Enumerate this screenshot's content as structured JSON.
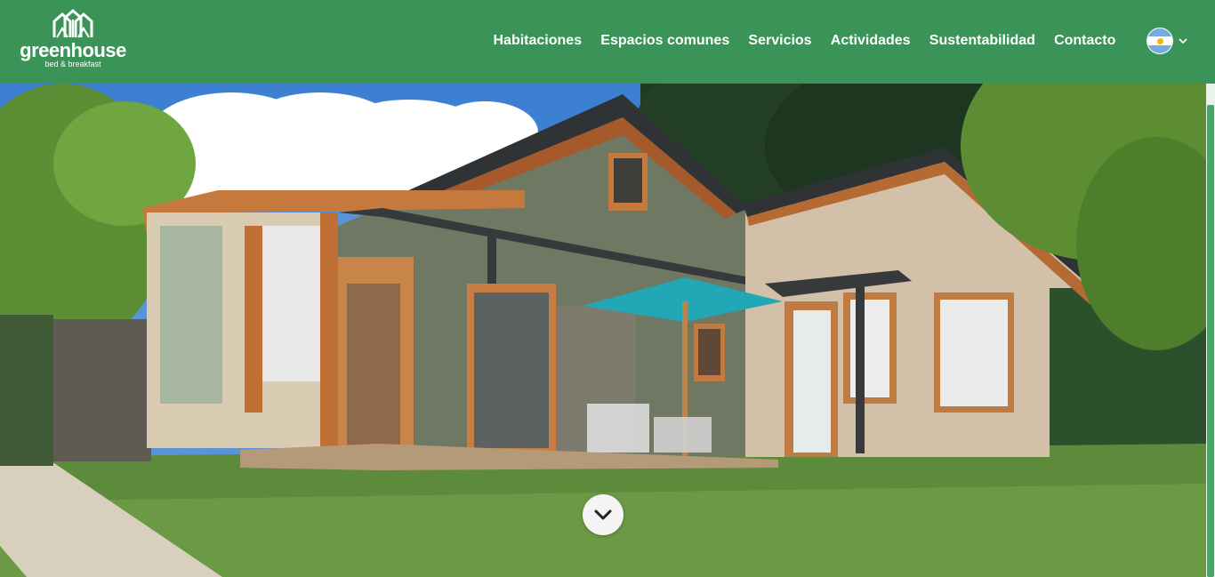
{
  "brand": {
    "name": "greenhouse",
    "tagline": "bed & breakfast"
  },
  "nav": {
    "items": [
      {
        "label": "Habitaciones"
      },
      {
        "label": "Espacios comunes"
      },
      {
        "label": "Servicios"
      },
      {
        "label": "Actividades"
      },
      {
        "label": "Sustentabilidad"
      },
      {
        "label": "Contacto"
      }
    ]
  },
  "language": {
    "flag_icon": "argentina-flag-icon",
    "dropdown_icon": "chevron-down-icon"
  },
  "hero": {
    "image_alt": "Greenhouse bed & breakfast house with garden",
    "scroll_icon": "chevron-down-icon"
  },
  "colors": {
    "header_bg": "#3a9458",
    "accent": "#49a568",
    "text": "#ffffff"
  }
}
